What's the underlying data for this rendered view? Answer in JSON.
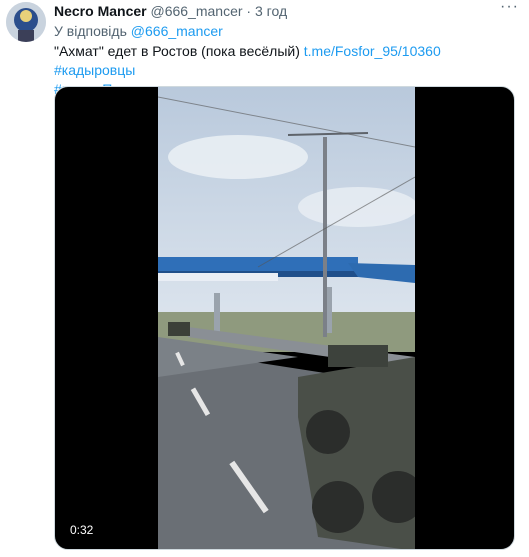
{
  "tweet": {
    "author_name": "Necro Mancer",
    "author_handle": "@666_mancer",
    "separator": "·",
    "time": "3 год",
    "more": "···",
    "reply_prefix": "У відповідь",
    "reply_handle": "@666_mancer",
    "text_main": "\"Ахмат\" едет в Ростов (пока весёлый) ",
    "link": "t.me/Fosfor_95/10360",
    "hashtag1": "#кадыровцы",
    "hashtag2": "#мятежПригожина"
  },
  "video": {
    "duration": "0:32"
  },
  "colors": {
    "accent": "#1d9bf0",
    "secondary_text": "#536471"
  }
}
